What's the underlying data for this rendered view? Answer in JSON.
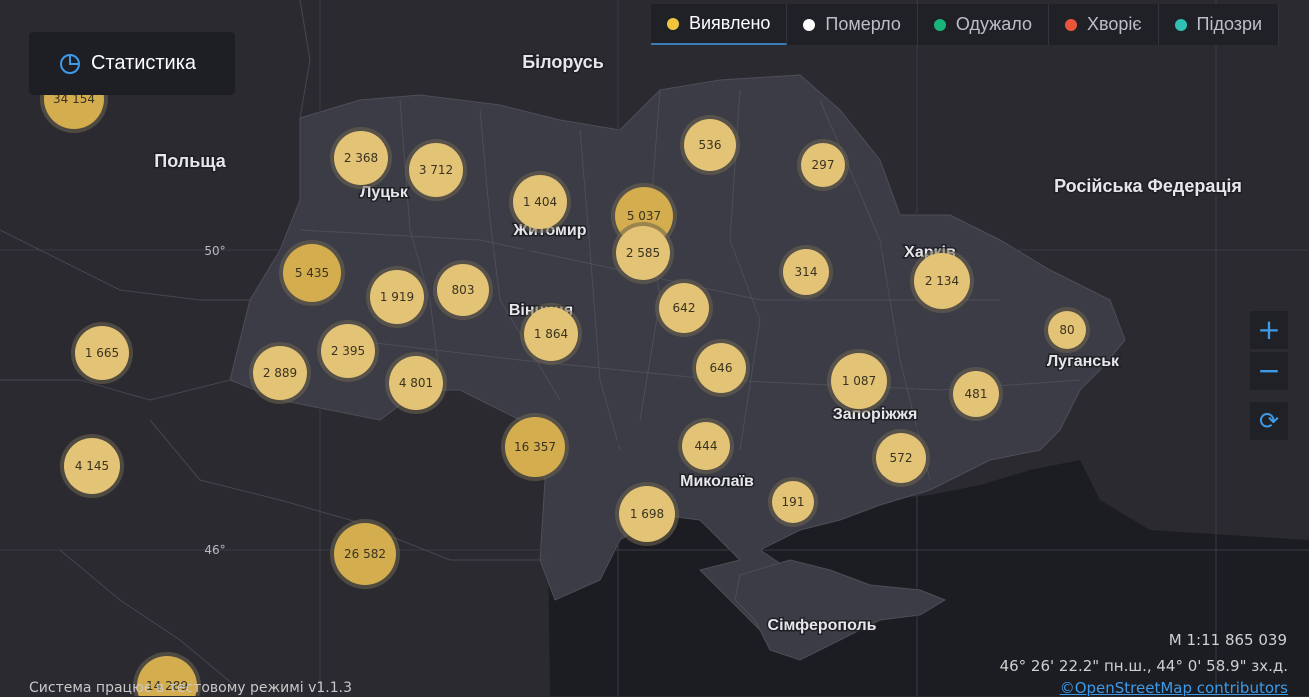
{
  "stat_button": {
    "label": "Статистика",
    "icon": "pie-chart-icon"
  },
  "tabs": [
    {
      "label": "Виявлено",
      "color": "#f0c43c",
      "active": true
    },
    {
      "label": "Померло",
      "color": "#ffffff",
      "active": false
    },
    {
      "label": "Одужало",
      "color": "#1ab37a",
      "active": false
    },
    {
      "label": "Хворіє",
      "color": "#e8553a",
      "active": false
    },
    {
      "label": "Підозри",
      "color": "#2fbfb3",
      "active": false
    }
  ],
  "country_labels": [
    "Білорусь",
    "Польща",
    "Російська Федерація"
  ],
  "city_labels": [
    "Луцьк",
    "Житомир",
    "Вінниця",
    "Харків",
    "Луганськ",
    "Запоріжжя",
    "Миколаїв",
    "Сімферополь"
  ],
  "latitude_labels": [
    "50°",
    "46°"
  ],
  "clusters": [
    {
      "value": "34 154"
    },
    {
      "value": "2 368"
    },
    {
      "value": "3 712"
    },
    {
      "value": "1 404"
    },
    {
      "value": "5 037"
    },
    {
      "value": "2 585"
    },
    {
      "value": "536"
    },
    {
      "value": "297"
    },
    {
      "value": "5 435"
    },
    {
      "value": "1 919"
    },
    {
      "value": "803"
    },
    {
      "value": "1 864"
    },
    {
      "value": "642"
    },
    {
      "value": "314"
    },
    {
      "value": "2 134"
    },
    {
      "value": "80"
    },
    {
      "value": "1 665"
    },
    {
      "value": "2 395"
    },
    {
      "value": "2 889"
    },
    {
      "value": "4 801"
    },
    {
      "value": "646"
    },
    {
      "value": "1 087"
    },
    {
      "value": "481"
    },
    {
      "value": "16 357"
    },
    {
      "value": "444"
    },
    {
      "value": "572"
    },
    {
      "value": "4 145"
    },
    {
      "value": "1 698"
    },
    {
      "value": "191"
    },
    {
      "value": "26 582"
    },
    {
      "value": "14 289"
    }
  ],
  "controls": {
    "zoom_in": "+",
    "zoom_out": "−",
    "reset": "⟳"
  },
  "scale": "M 1:11 865 039",
  "coordinates": "46° 26' 22.2\" пн.ш., 44° 0' 58.9\" зх.д.",
  "attribution": "©OpenStreetMap contributors",
  "footer": "Система працює в тестовому режимі v1.1.3",
  "colors": {
    "marker": "#e3c375",
    "marker_dark": "#d3ad4e",
    "ukraine": "#3b3c45",
    "sea": "#1c1d22"
  }
}
